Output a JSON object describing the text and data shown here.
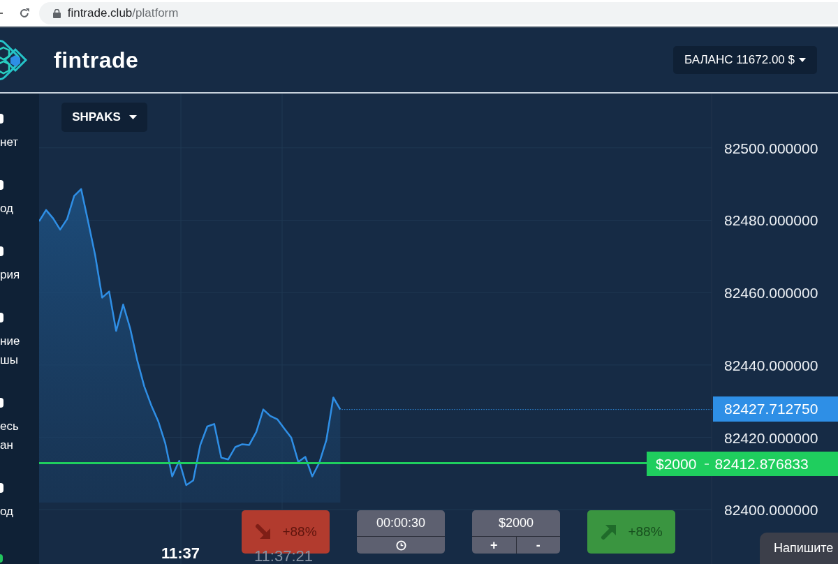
{
  "browser": {
    "url_host": "fintrade.club",
    "url_path": "/platform"
  },
  "header": {
    "brand": "fintrade",
    "balance": "БАЛАНС 11672.00 $"
  },
  "sidebar": {
    "items": [
      {
        "lines": [
          "нет"
        ]
      },
      {
        "lines": [
          "од"
        ]
      },
      {
        "lines": [
          "рия"
        ]
      },
      {
        "lines": [
          "ние",
          "шы"
        ]
      },
      {
        "lines": [
          "есь",
          "ан"
        ]
      },
      {
        "lines": [
          "од"
        ]
      }
    ]
  },
  "asset_selector": {
    "label": "SHPAKS"
  },
  "chart": {
    "x_label": "11:37",
    "current_time": "11:37:21",
    "chart_data": {
      "type": "line",
      "ylim": [
        82385,
        82515
      ],
      "yticks": [
        {
          "value": 82500,
          "label": "82500.000000"
        },
        {
          "value": 82480,
          "label": "82480.000000"
        },
        {
          "value": 82460,
          "label": "82460.000000"
        },
        {
          "value": 82440,
          "label": "82440.000000"
        },
        {
          "value": 82420,
          "label": "82420.000000"
        },
        {
          "value": 82400,
          "label": "82400.000000"
        }
      ],
      "grid": true,
      "categories": [
        null,
        null,
        null,
        null,
        null,
        null,
        null,
        null,
        null,
        null,
        null,
        null,
        null,
        null,
        null,
        null,
        null,
        null,
        null,
        null,
        null,
        null,
        null,
        null,
        null,
        null,
        null,
        null,
        null,
        null,
        null,
        null,
        null,
        null,
        null,
        null,
        null,
        null,
        null,
        null,
        null,
        null,
        null,
        null,
        null,
        null,
        null,
        null,
        null,
        null,
        null,
        null,
        null,
        null,
        null,
        null,
        null,
        null,
        null,
        null,
        null,
        null,
        null,
        null,
        null,
        null,
        null,
        null,
        null,
        null,
        null,
        null,
        null,
        null,
        null,
        null,
        null,
        null,
        null,
        null,
        null,
        null,
        null,
        null,
        null,
        null,
        null,
        null,
        null,
        null,
        null,
        null,
        null,
        null,
        null,
        null,
        null
      ],
      "series": [
        {
          "color": "#2f8fe6",
          "values": [
            82479.7,
            82482.8,
            82480.5,
            82477.4,
            82480.3,
            82486.7,
            82488.6,
            82479.6,
            82470.3,
            82458.6,
            82460.3,
            82449.4,
            82456.7,
            82450.1,
            82441.4,
            82434.1,
            82428.9,
            82424.5,
            82418.4,
            82409.2,
            82413.5,
            82406.8,
            82408.1,
            82417.8,
            82423.0,
            82423.7,
            82414.4,
            82413.9,
            82417.3,
            82418.1,
            82417.9,
            82421.5,
            82427.7,
            82425.9,
            82425.0,
            82422.4,
            82419.9,
            82413.2,
            82414.6,
            82409.2,
            82413.0,
            82419.2,
            82431.0,
            82427.7,
            null,
            null,
            null,
            null,
            null,
            null,
            null,
            null,
            null,
            null,
            null,
            null,
            null,
            null,
            null,
            null,
            null,
            null,
            null,
            null,
            null,
            null,
            null,
            null,
            null,
            null,
            null,
            null,
            null,
            null,
            null,
            null,
            null,
            null,
            null,
            null,
            null,
            null,
            null,
            null,
            null,
            null,
            null,
            null,
            null,
            null,
            null,
            null,
            null,
            null,
            null,
            null,
            null
          ]
        }
      ]
    }
  },
  "price_marker": {
    "value": "82427.712750"
  },
  "deal_marker": {
    "amount": "$2000",
    "value": "82412.876833"
  },
  "controls": [
    {
      "kind": "down",
      "payout": "+88%"
    },
    {
      "kind": "timer",
      "value": "00:00:30"
    },
    {
      "kind": "amount",
      "value": "$2000",
      "increase": "+",
      "decrease": "-"
    },
    {
      "kind": "up",
      "payout": "+88%"
    }
  ],
  "chat": {
    "label": "Напишите"
  }
}
